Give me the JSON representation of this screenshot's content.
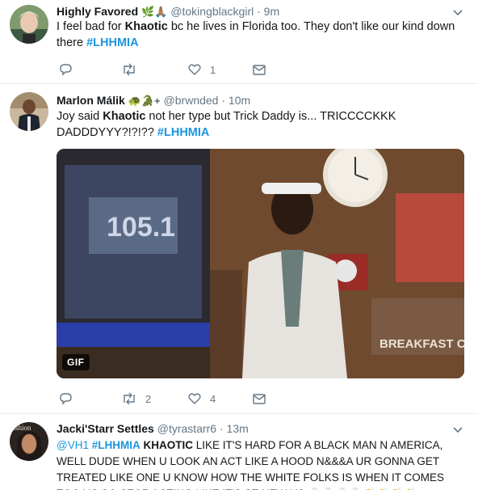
{
  "tweets": [
    {
      "name": "Highly Favored",
      "name_emoji": "🌿🙏🏽",
      "handle": "@tokingblackgirl",
      "separator": "·",
      "time": "9m",
      "text_before": "I feel bad for ",
      "text_bold": "Khaotic",
      "text_after": " bc he lives in Florida too. They don't like our kind down there ",
      "hashtag": "#LHHMIA",
      "reply_count": "",
      "retweet_count": "",
      "like_count": "1"
    },
    {
      "name": "Marlon Málik",
      "name_emoji": "🐢🐊+",
      "handle": "@brwnded",
      "separator": "·",
      "time": "10m",
      "text_before": "Joy said ",
      "text_bold": "Khaotic",
      "text_after": " not her type but Trick Daddy is... TRICCCCKKK DADDDYYY?!?!?? ",
      "hashtag": "#LHHMIA",
      "media_label": "GIF",
      "media_sign": "105.1",
      "media_sign2": "BREAKFAST CLUB",
      "reply_count": "",
      "retweet_count": "2",
      "like_count": "4"
    },
    {
      "name": "Jacki'Starr Settles",
      "handle": "@tyrastarr6",
      "separator": "·",
      "time": "13m",
      "mention": "@VH1",
      "hashtag": "#LHHMIA",
      "text_bold": "KHAOTIC",
      "text_after": " LIKE IT'S HARD FOR A BLACK MAN N AMERICA, WELL DUDE WHEN U LOOK AN ACT LIKE A HOOD N&&&A UR GONNA GET TREATED LIKE ONE U KNOW HOW THE WHITE FOLKS IS WHEN IT COMES TOO US SO STOP ACTING LIKE IT'S ST NEW US 🍷🍷🍷🍷👏👏👏👏",
      "avatar_text": "ashion"
    }
  ],
  "colors": {
    "link": "#1b95e0",
    "muted": "#657786",
    "divider": "#e6ecf0"
  },
  "icons": {
    "reply": "reply-icon",
    "retweet": "retweet-icon",
    "like": "heart-icon",
    "dm": "envelope-icon",
    "caret": "chevron-down-icon"
  }
}
